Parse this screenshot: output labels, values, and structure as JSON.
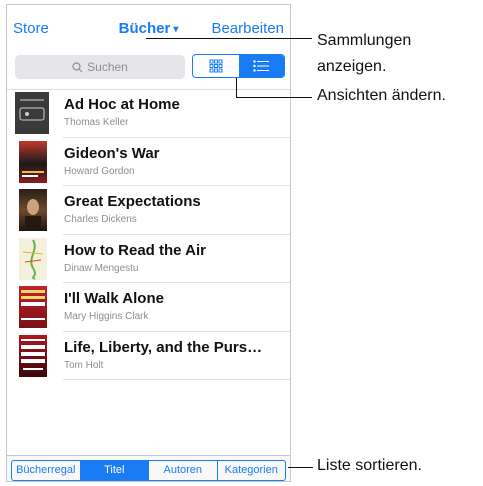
{
  "navbar": {
    "store": "Store",
    "title": "Bücher",
    "title_caret": "▾",
    "edit": "Bearbeiten"
  },
  "toolbar": {
    "search_placeholder": "Suchen",
    "view_toggle_selected": "list"
  },
  "books": [
    {
      "title": "Ad Hoc at Home",
      "author": "Thomas Keller"
    },
    {
      "title": "Gideon's War",
      "author": "Howard Gordon"
    },
    {
      "title": "Great Expectations",
      "author": "Charles Dickens"
    },
    {
      "title": "How to Read the Air",
      "author": "Dinaw Mengestu"
    },
    {
      "title": "I'll Walk Alone",
      "author": "Mary Higgins Clark"
    },
    {
      "title": "Life, Liberty, and the Purs…",
      "author": "Tom Holt"
    }
  ],
  "tabs": [
    "Bücherregal",
    "Titel",
    "Autoren",
    "Kategorien"
  ],
  "active_tab": "Titel",
  "callouts": {
    "collections_line1": "Sammlungen",
    "collections_line2": "anzeigen.",
    "views": "Ansichten ändern.",
    "sort": "Liste sortieren."
  },
  "colors": {
    "accent": "#1a7cf5"
  }
}
